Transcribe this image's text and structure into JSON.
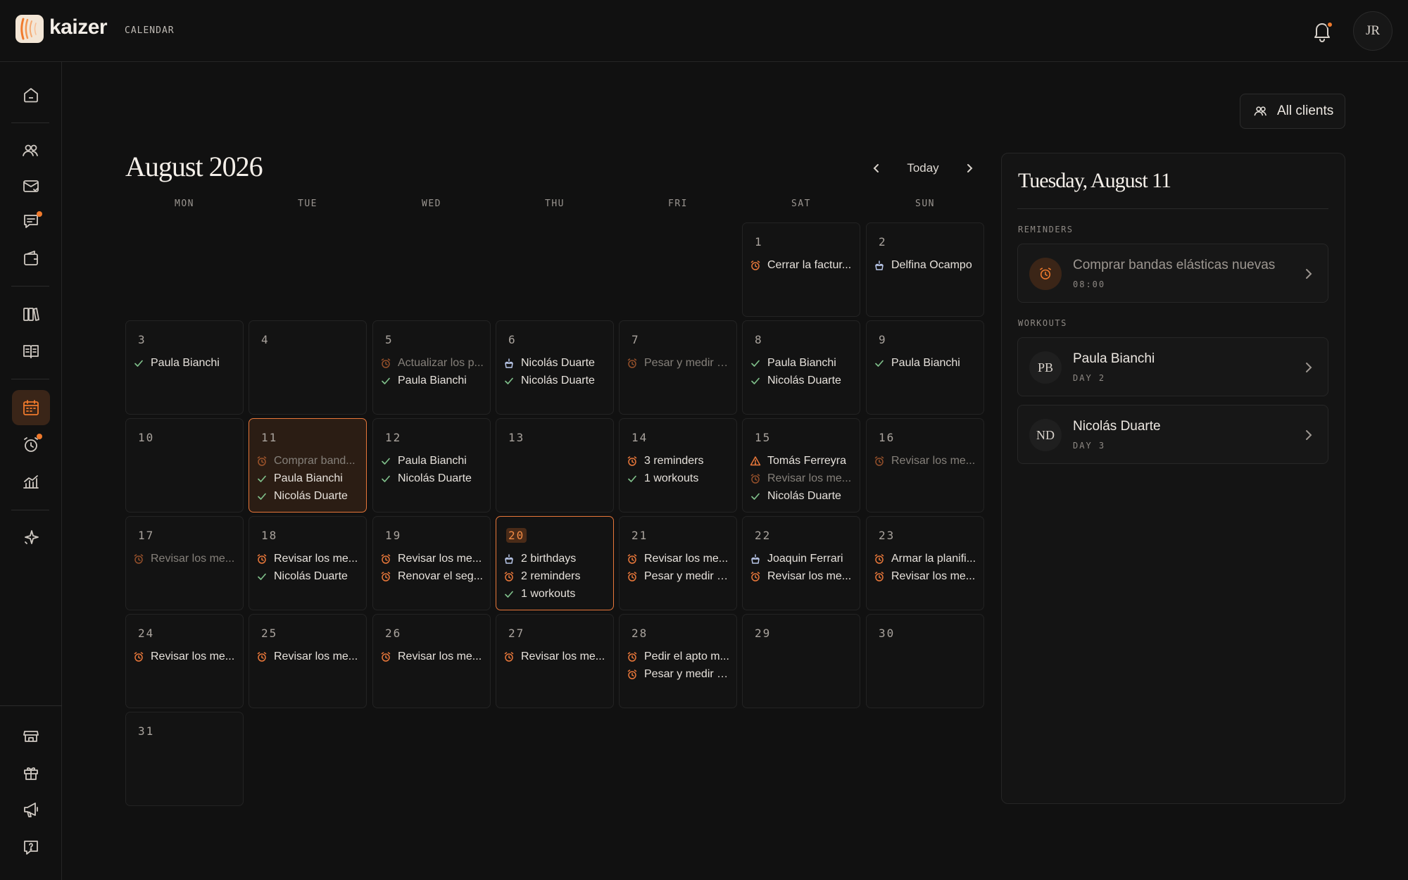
{
  "app": {
    "brand": "kaizer",
    "section": "CALENDAR",
    "user_initials": "JR"
  },
  "toolbar": {
    "all_clients_label": "All clients",
    "today_label": "Today"
  },
  "calendar": {
    "month_title": "August 2026",
    "weekdays": [
      "MON",
      "TUE",
      "WED",
      "THU",
      "FRI",
      "SAT",
      "SUN"
    ],
    "days": [
      {
        "num": "1",
        "events": [
          {
            "icon": "alarm",
            "text": "Cerrar la factur...",
            "dim": false
          }
        ]
      },
      {
        "num": "2",
        "events": [
          {
            "icon": "cake",
            "text": "Delfina Ocampo",
            "dim": false
          }
        ]
      },
      {
        "num": "3",
        "events": [
          {
            "icon": "check",
            "text": "Paula Bianchi",
            "dim": false
          }
        ]
      },
      {
        "num": "4",
        "events": []
      },
      {
        "num": "5",
        "events": [
          {
            "icon": "alarm",
            "text": "Actualizar los p...",
            "dim": true
          },
          {
            "icon": "check",
            "text": "Paula Bianchi",
            "dim": false
          }
        ]
      },
      {
        "num": "6",
        "events": [
          {
            "icon": "cake",
            "text": "Nicolás Duarte",
            "dim": false
          },
          {
            "icon": "check",
            "text": "Nicolás Duarte",
            "dim": false
          }
        ]
      },
      {
        "num": "7",
        "events": [
          {
            "icon": "alarm",
            "text": "Pesar y medir a...",
            "dim": true
          }
        ]
      },
      {
        "num": "8",
        "events": [
          {
            "icon": "check",
            "text": "Paula Bianchi",
            "dim": false
          },
          {
            "icon": "check",
            "text": "Nicolás Duarte",
            "dim": false
          }
        ]
      },
      {
        "num": "9",
        "events": [
          {
            "icon": "check",
            "text": "Paula Bianchi",
            "dim": false
          }
        ]
      },
      {
        "num": "10",
        "events": []
      },
      {
        "num": "11",
        "events": [
          {
            "icon": "alarm",
            "text": "Comprar band...",
            "dim": true
          },
          {
            "icon": "check",
            "text": "Paula Bianchi",
            "dim": false
          },
          {
            "icon": "check",
            "text": "Nicolás Duarte",
            "dim": false
          }
        ]
      },
      {
        "num": "12",
        "events": [
          {
            "icon": "check",
            "text": "Paula Bianchi",
            "dim": false
          },
          {
            "icon": "check",
            "text": "Nicolás Duarte",
            "dim": false
          }
        ]
      },
      {
        "num": "13",
        "events": []
      },
      {
        "num": "14",
        "events": [
          {
            "icon": "alarm",
            "text": "3 reminders",
            "dim": false
          },
          {
            "icon": "check",
            "text": "1 workouts",
            "dim": false
          }
        ]
      },
      {
        "num": "15",
        "events": [
          {
            "icon": "warning",
            "text": "Tomás Ferreyra",
            "dim": false
          },
          {
            "icon": "alarm",
            "text": "Revisar los me...",
            "dim": true
          },
          {
            "icon": "check",
            "text": "Nicolás Duarte",
            "dim": false
          }
        ]
      },
      {
        "num": "16",
        "events": [
          {
            "icon": "alarm",
            "text": "Revisar los me...",
            "dim": true
          }
        ]
      },
      {
        "num": "17",
        "events": [
          {
            "icon": "alarm",
            "text": "Revisar los me...",
            "dim": true
          }
        ]
      },
      {
        "num": "18",
        "events": [
          {
            "icon": "alarm",
            "text": "Revisar los me...",
            "dim": false
          },
          {
            "icon": "check",
            "text": "Nicolás Duarte",
            "dim": false
          }
        ]
      },
      {
        "num": "19",
        "events": [
          {
            "icon": "alarm",
            "text": "Revisar los me...",
            "dim": false
          },
          {
            "icon": "alarm",
            "text": "Renovar el seg...",
            "dim": false
          }
        ]
      },
      {
        "num": "20",
        "events": [
          {
            "icon": "cake",
            "text": "2 birthdays",
            "dim": false
          },
          {
            "icon": "alarm",
            "text": "2 reminders",
            "dim": false
          },
          {
            "icon": "check",
            "text": "1 workouts",
            "dim": false
          }
        ]
      },
      {
        "num": "21",
        "events": [
          {
            "icon": "alarm",
            "text": "Revisar los me...",
            "dim": false
          },
          {
            "icon": "alarm",
            "text": "Pesar y medir a...",
            "dim": false
          }
        ]
      },
      {
        "num": "22",
        "events": [
          {
            "icon": "cake",
            "text": "Joaquin Ferrari",
            "dim": false
          },
          {
            "icon": "alarm",
            "text": "Revisar los me...",
            "dim": false
          }
        ]
      },
      {
        "num": "23",
        "events": [
          {
            "icon": "alarm",
            "text": "Armar la planifi...",
            "dim": false
          },
          {
            "icon": "alarm",
            "text": "Revisar los me...",
            "dim": false
          }
        ]
      },
      {
        "num": "24",
        "events": [
          {
            "icon": "alarm",
            "text": "Revisar los me...",
            "dim": false
          }
        ]
      },
      {
        "num": "25",
        "events": [
          {
            "icon": "alarm",
            "text": "Revisar los me...",
            "dim": false
          }
        ]
      },
      {
        "num": "26",
        "events": [
          {
            "icon": "alarm",
            "text": "Revisar los me...",
            "dim": false
          }
        ]
      },
      {
        "num": "27",
        "events": [
          {
            "icon": "alarm",
            "text": "Revisar los me...",
            "dim": false
          }
        ]
      },
      {
        "num": "28",
        "events": [
          {
            "icon": "alarm",
            "text": "Pedir el apto m...",
            "dim": false
          },
          {
            "icon": "alarm",
            "text": "Pesar y medir a...",
            "dim": false
          }
        ]
      },
      {
        "num": "29",
        "events": []
      },
      {
        "num": "30",
        "events": []
      },
      {
        "num": "31",
        "events": []
      }
    ],
    "selected_day": "11",
    "today_day": "20"
  },
  "panel": {
    "title": "Tuesday, August 11",
    "reminders_heading": "REMINDERS",
    "reminders": [
      {
        "title": "Comprar bandas elásticas nuevas",
        "time": "08:00"
      }
    ],
    "workouts_heading": "WORKOUTS",
    "workouts": [
      {
        "initials": "PB",
        "name": "Paula Bianchi",
        "day": "DAY 2"
      },
      {
        "initials": "ND",
        "name": "Nicolás Duarte",
        "day": "DAY 3"
      }
    ]
  },
  "colors": {
    "accent": "#e8773a",
    "background": "#111111",
    "check": "#7fbf8a",
    "birthday": "#b8c6e8"
  },
  "icons": {
    "sidebar": [
      "home-icon",
      "users-icon",
      "mail-icon",
      "chat-icon",
      "wallet-icon",
      "books-icon",
      "guide-icon",
      "calendar-icon",
      "alarm-icon",
      "chart-icon",
      "sparkle-icon",
      "store-icon",
      "gift-icon",
      "megaphone-icon",
      "help-icon"
    ]
  }
}
